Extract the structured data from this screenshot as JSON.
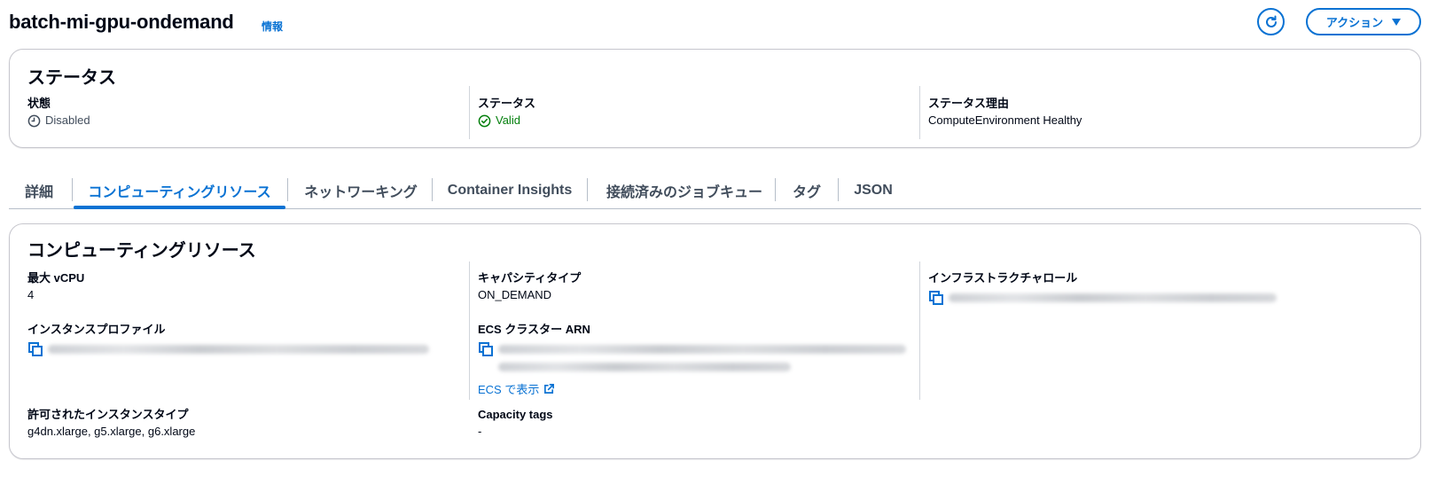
{
  "header": {
    "title": "batch-mi-gpu-ondemand",
    "info": "情報",
    "actions_label": "アクション",
    "refresh_icon": "refresh-icon",
    "accent": "#0972d3"
  },
  "status_panel": {
    "title": "ステータス",
    "state_label": "状態",
    "state_value": "Disabled",
    "status_label": "ステータス",
    "status_value": "Valid",
    "reason_label": "ステータス理由",
    "reason_value": "ComputeEnvironment Healthy",
    "success_color": "#037f0c"
  },
  "tabs": [
    {
      "label": "詳細",
      "active": false
    },
    {
      "label": "コンピューティングリソース",
      "active": true
    },
    {
      "label": "ネットワーキング",
      "active": false
    },
    {
      "label": "Container Insights",
      "active": false
    },
    {
      "label": "接続済みのジョブキュー",
      "active": false
    },
    {
      "label": "タグ",
      "active": false
    },
    {
      "label": "JSON",
      "active": false
    }
  ],
  "compute_panel": {
    "title": "コンピューティングリソース",
    "max_vcpu_label": "最大 vCPU",
    "max_vcpu_value": "4",
    "instance_profile_label": "インスタンスプロファイル",
    "allowed_types_label": "許可されたインスタンスタイプ",
    "allowed_types_value": "g4dn.xlarge, g5.xlarge, g6.xlarge",
    "capacity_type_label": "キャパシティタイプ",
    "capacity_type_value": "ON_DEMAND",
    "ecs_arn_label": "ECS クラスター ARN",
    "ecs_link": "ECS で表示",
    "capacity_tags_label": "Capacity tags",
    "capacity_tags_value": "-",
    "infra_role_label": "インフラストラクチャロール"
  }
}
